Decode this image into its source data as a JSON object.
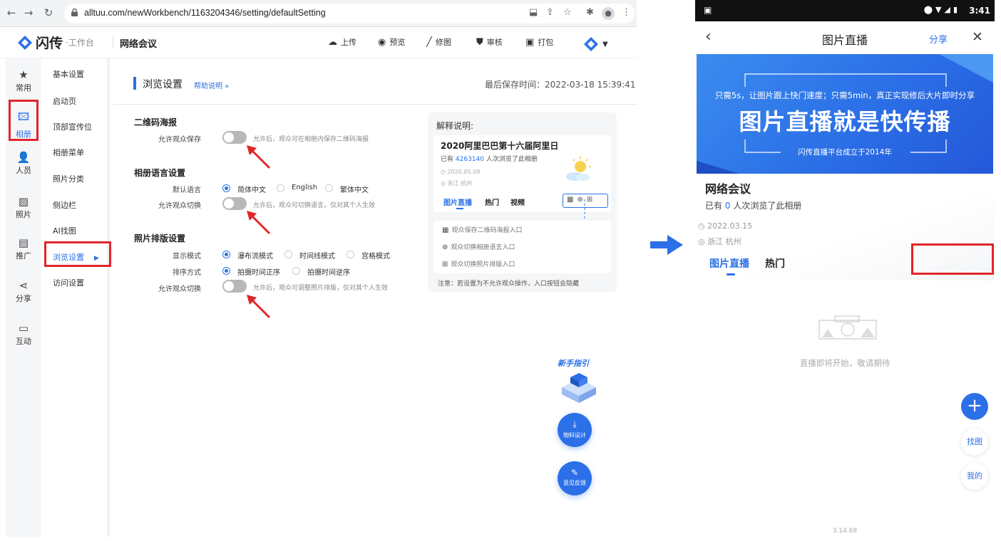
{
  "browser": {
    "url": "alltuu.com/newWorkbench/1163204346/setting/defaultSetting"
  },
  "app": {
    "brand": "闪传",
    "brand_sub": "·工作台",
    "album_title": "网络会议",
    "actions": [
      {
        "icon": "cloud-upload-icon",
        "label": "上传"
      },
      {
        "icon": "eye-icon",
        "label": "预览"
      },
      {
        "icon": "brush-icon",
        "label": "修图"
      },
      {
        "icon": "shield-icon",
        "label": "审核"
      },
      {
        "icon": "package-icon",
        "label": "打包"
      }
    ]
  },
  "rail": [
    {
      "icon": "star-icon",
      "label": "常用"
    },
    {
      "icon": "album-icon",
      "label": "相册",
      "active": true
    },
    {
      "icon": "person-icon",
      "label": "人员"
    },
    {
      "icon": "photo-icon",
      "label": "照片"
    },
    {
      "icon": "promote-icon",
      "label": "推广"
    },
    {
      "icon": "share-icon",
      "label": "分享"
    },
    {
      "icon": "chat-icon",
      "label": "互动"
    }
  ],
  "menu": [
    {
      "label": "基本设置"
    },
    {
      "label": "启动页"
    },
    {
      "label": "顶部宣传位"
    },
    {
      "label": "相册菜单"
    },
    {
      "label": "照片分类"
    },
    {
      "label": "侧边栏"
    },
    {
      "label": "AI找图"
    },
    {
      "label": "浏览设置",
      "active": true
    },
    {
      "label": "访问设置"
    }
  ],
  "main": {
    "title": "浏览设置",
    "help": "帮助说明 »",
    "saved": "最后保存时间：2022-03-18 15:39:41",
    "qr": {
      "title": "二维码海报",
      "label": "允许观众保存",
      "hint": "允许后，观众可在相册内保存二维码海报"
    },
    "lang": {
      "title": "相册语言设置",
      "default_label": "默认语言",
      "options": [
        "简体中文",
        "English",
        "繁体中文"
      ],
      "switch_label": "允许观众切换",
      "switch_hint": "允许后，观众可切换语言，仅对其个人生效"
    },
    "layout": {
      "title": "照片排版设置",
      "mode_label": "显示模式",
      "modes": [
        "瀑布流模式",
        "时间线模式",
        "宫格模式"
      ],
      "sort_label": "排序方式",
      "sorts": [
        "拍摄时间正序",
        "拍摄时间逆序"
      ],
      "switch_label": "允许观众切换",
      "switch_hint": "允许后，观众可调整照片排版，仅对其个人生效"
    }
  },
  "explain": {
    "head": "解释说明:",
    "card_title": "2020阿里巴巴第十六届阿里日",
    "viewed_prefix": "已有",
    "viewed_count": "4263140",
    "viewed_suffix": "人次浏览了此相册",
    "date": "2020.05.09",
    "location": "浙江 杭州",
    "tabs": [
      "图片直播",
      "热门",
      "视频"
    ],
    "rows": [
      "观众保存二维码海报入口",
      "观众切换相册语言入口",
      "观众切换照片排版入口"
    ],
    "note": "注意：若设置为不允许观众操作，入口按钮会隐藏"
  },
  "floating": {
    "guide": "新手指引",
    "material": "物料设计",
    "feedback": "意见反馈"
  },
  "phone": {
    "time": "3:41",
    "title": "图片直播",
    "share": "分享",
    "banner_small": "只需5s，让图片跟上快门速度；只需5min，真正实现修后大片即时分享",
    "banner_big": "图片直播就是快传播",
    "banner_foot": "闪传直播平台成立于2014年",
    "album": "网络会议",
    "viewed_prefix": "已有",
    "viewed_count": "0",
    "viewed_suffix": "人次浏览了此相册",
    "date": "2022.03.15",
    "location": "浙江 杭州",
    "tabs": [
      "图片直播",
      "热门"
    ],
    "empty": "直播即将开始，敬请期待",
    "find": "找图",
    "mine": "我的",
    "version": "3.14.68"
  },
  "colors": {
    "accent": "#2c70e8",
    "highlight": "#e0262b"
  }
}
